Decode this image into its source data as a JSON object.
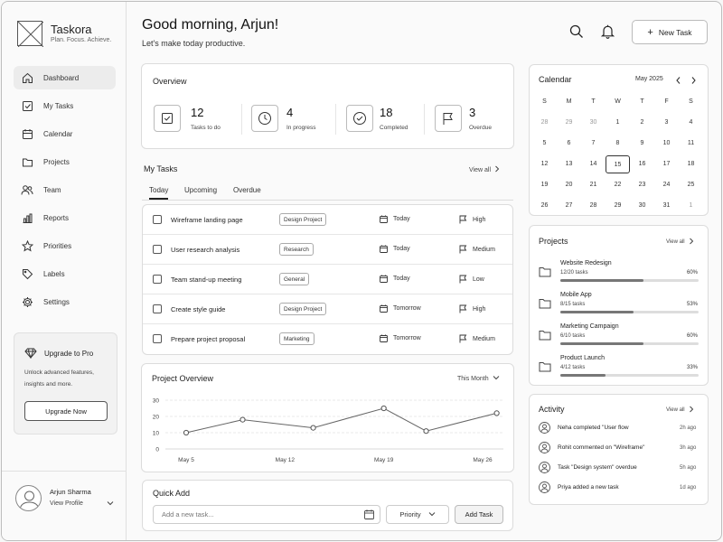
{
  "brand": {
    "name": "Taskora",
    "tagline": "Plan. Focus. Achieve."
  },
  "sidebar": {
    "items": [
      {
        "label": "Dashboard",
        "icon": "home-icon",
        "active": true
      },
      {
        "label": "My Tasks",
        "icon": "checkbox-icon"
      },
      {
        "label": "Calendar",
        "icon": "calendar-icon"
      },
      {
        "label": "Projects",
        "icon": "folder-icon"
      },
      {
        "label": "Team",
        "icon": "team-icon"
      },
      {
        "label": "Reports",
        "icon": "bar-chart-icon"
      },
      {
        "label": "Priorities",
        "icon": "star-icon"
      },
      {
        "label": "Labels",
        "icon": "tag-icon"
      },
      {
        "label": "Settings",
        "icon": "gear-icon"
      }
    ],
    "upgrade": {
      "title": "Upgrade to Pro",
      "text": "Unlock advanced features, insights and more.",
      "button": "Upgrade Now"
    },
    "profile": {
      "name": "Arjun Sharma",
      "link": "View Profile"
    }
  },
  "header": {
    "title": "Good morning, Arjun!",
    "subtitle": "Let's make today productive.",
    "new_task": "New Task"
  },
  "overview": {
    "title": "Overview",
    "stats": [
      {
        "value": "12",
        "label": "Tasks to do",
        "icon": "checkbox-icon"
      },
      {
        "value": "4",
        "label": "In progress",
        "icon": "clock-icon"
      },
      {
        "value": "18",
        "label": "Completed",
        "icon": "check-circle-icon"
      },
      {
        "value": "3",
        "label": "Overdue",
        "icon": "flag-icon"
      }
    ]
  },
  "my_tasks": {
    "title": "My Tasks",
    "view_all": "View all",
    "tabs": [
      "Today",
      "Upcoming",
      "Overdue"
    ],
    "rows": [
      {
        "name": "Wireframe landing page",
        "tag": "Design Project",
        "due": "Today",
        "priority": "High"
      },
      {
        "name": "User research analysis",
        "tag": "Research",
        "due": "Today",
        "priority": "Medium"
      },
      {
        "name": "Team stand-up meeting",
        "tag": "General",
        "due": "Today",
        "priority": "Low"
      },
      {
        "name": "Create style guide",
        "tag": "Design Project",
        "due": "Tomorrow",
        "priority": "High"
      },
      {
        "name": "Prepare project proposal",
        "tag": "Marketing",
        "due": "Tomorrow",
        "priority": "Medium"
      }
    ]
  },
  "project_overview": {
    "title": "Project Overview",
    "range": "This Month"
  },
  "chart_data": {
    "type": "line",
    "x": [
      "May 5",
      "May 12",
      "May 19",
      "May 26"
    ],
    "points": [
      {
        "x": "May 5",
        "y": 10
      },
      {
        "x": "May 9",
        "y": 18
      },
      {
        "x": "May 14",
        "y": 13
      },
      {
        "x": "May 19",
        "y": 25
      },
      {
        "x": "May 22",
        "y": 11
      },
      {
        "x": "May 27",
        "y": 22
      }
    ],
    "yticks": [
      0,
      10,
      20,
      30
    ],
    "ylim": [
      0,
      30
    ],
    "grid": true
  },
  "quick_add": {
    "title": "Quick Add",
    "placeholder": "Add a new task...",
    "priority": "Priority",
    "button": "Add Task"
  },
  "calendar": {
    "title": "Calendar",
    "month": "May 2025",
    "dow": [
      "S",
      "M",
      "T",
      "W",
      "T",
      "F",
      "S"
    ],
    "weeks": [
      [
        "28",
        "29",
        "30",
        "1",
        "2",
        "3",
        "4"
      ],
      [
        "5",
        "6",
        "7",
        "8",
        "9",
        "10",
        "11"
      ],
      [
        "12",
        "13",
        "14",
        "15",
        "16",
        "17",
        "18"
      ],
      [
        "19",
        "20",
        "21",
        "22",
        "23",
        "24",
        "25"
      ],
      [
        "26",
        "27",
        "28",
        "29",
        "30",
        "31",
        "1"
      ]
    ],
    "muted": [
      [
        0,
        0
      ],
      [
        0,
        1
      ],
      [
        0,
        2
      ],
      [
        4,
        6
      ]
    ],
    "today": [
      2,
      3
    ]
  },
  "projects": {
    "title": "Projects",
    "view_all": "View all",
    "items": [
      {
        "name": "Website Redesign",
        "count": "12/20 tasks",
        "pct": "60%",
        "progress": 0.6
      },
      {
        "name": "Mobile App",
        "count": "8/15 tasks",
        "pct": "53%",
        "progress": 0.53
      },
      {
        "name": "Marketing Campaign",
        "count": "6/10 tasks",
        "pct": "60%",
        "progress": 0.6
      },
      {
        "name": "Product Launch",
        "count": "4/12 tasks",
        "pct": "33%",
        "progress": 0.33
      }
    ]
  },
  "activity": {
    "title": "Activity",
    "view_all": "View all",
    "items": [
      {
        "text": "Neha completed \"User flow",
        "time": "2h ago"
      },
      {
        "text": "Rohit commented on \"Wireframe\"",
        "time": "3h ago"
      },
      {
        "text": "Task \"Design system\" overdue",
        "time": "5h ago"
      },
      {
        "text": "Priya added a new task",
        "time": "1d ago"
      }
    ]
  }
}
